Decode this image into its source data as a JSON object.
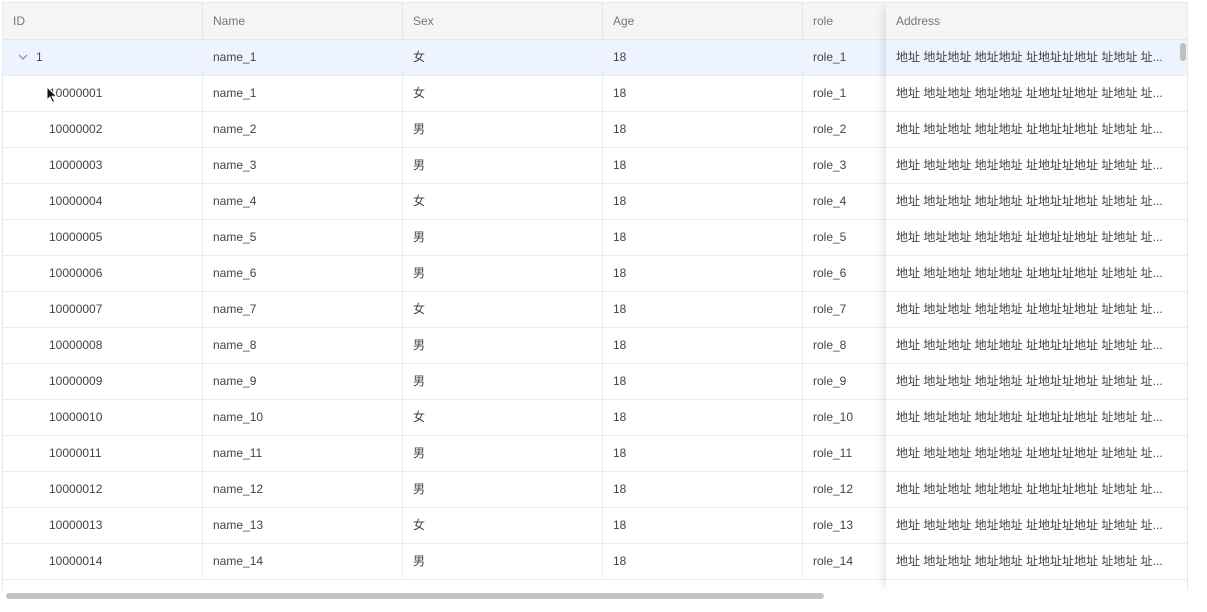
{
  "columns": {
    "id": "ID",
    "name": "Name",
    "sex": "Sex",
    "age": "Age",
    "role": "role",
    "address": "Address"
  },
  "rows": [
    {
      "id": "1",
      "name": "name_1",
      "sex": "女",
      "age": "18",
      "role": "role_1",
      "address": "地址 地址地址 地址地址 址地址址地址 址地址 址..."
    },
    {
      "id": "10000001",
      "name": "name_1",
      "sex": "女",
      "age": "18",
      "role": "role_1",
      "address": "地址 地址地址 地址地址 址地址址地址 址地址 址..."
    },
    {
      "id": "10000002",
      "name": "name_2",
      "sex": "男",
      "age": "18",
      "role": "role_2",
      "address": "地址 地址地址 地址地址 址地址址地址 址地址 址..."
    },
    {
      "id": "10000003",
      "name": "name_3",
      "sex": "男",
      "age": "18",
      "role": "role_3",
      "address": "地址 地址地址 地址地址 址地址址地址 址地址 址..."
    },
    {
      "id": "10000004",
      "name": "name_4",
      "sex": "女",
      "age": "18",
      "role": "role_4",
      "address": "地址 地址地址 地址地址 址地址址地址 址地址 址..."
    },
    {
      "id": "10000005",
      "name": "name_5",
      "sex": "男",
      "age": "18",
      "role": "role_5",
      "address": "地址 地址地址 地址地址 址地址址地址 址地址 址..."
    },
    {
      "id": "10000006",
      "name": "name_6",
      "sex": "男",
      "age": "18",
      "role": "role_6",
      "address": "地址 地址地址 地址地址 址地址址地址 址地址 址..."
    },
    {
      "id": "10000007",
      "name": "name_7",
      "sex": "女",
      "age": "18",
      "role": "role_7",
      "address": "地址 地址地址 地址地址 址地址址地址 址地址 址..."
    },
    {
      "id": "10000008",
      "name": "name_8",
      "sex": "男",
      "age": "18",
      "role": "role_8",
      "address": "地址 地址地址 地址地址 址地址址地址 址地址 址..."
    },
    {
      "id": "10000009",
      "name": "name_9",
      "sex": "男",
      "age": "18",
      "role": "role_9",
      "address": "地址 地址地址 地址地址 址地址址地址 址地址 址..."
    },
    {
      "id": "10000010",
      "name": "name_10",
      "sex": "女",
      "age": "18",
      "role": "role_10",
      "address": "地址 地址地址 地址地址 址地址址地址 址地址 址..."
    },
    {
      "id": "10000011",
      "name": "name_11",
      "sex": "男",
      "age": "18",
      "role": "role_11",
      "address": "地址 地址地址 地址地址 址地址址地址 址地址 址..."
    },
    {
      "id": "10000012",
      "name": "name_12",
      "sex": "男",
      "age": "18",
      "role": "role_12",
      "address": "地址 地址地址 地址地址 址地址址地址 址地址 址..."
    },
    {
      "id": "10000013",
      "name": "name_13",
      "sex": "女",
      "age": "18",
      "role": "role_13",
      "address": "地址 地址地址 地址地址 址地址址地址 址地址 址..."
    },
    {
      "id": "10000014",
      "name": "name_14",
      "sex": "男",
      "age": "18",
      "role": "role_14",
      "address": "地址 地址地址 地址地址 址地址址地址 址地址 址..."
    }
  ],
  "icons": {
    "toggle": "chevron-down-icon",
    "cursor": "mouse-pointer-icon"
  },
  "colors": {
    "selected_row": "#eef4ff",
    "header_bg": "#f5f5f5",
    "border": "#e6e6e6"
  }
}
